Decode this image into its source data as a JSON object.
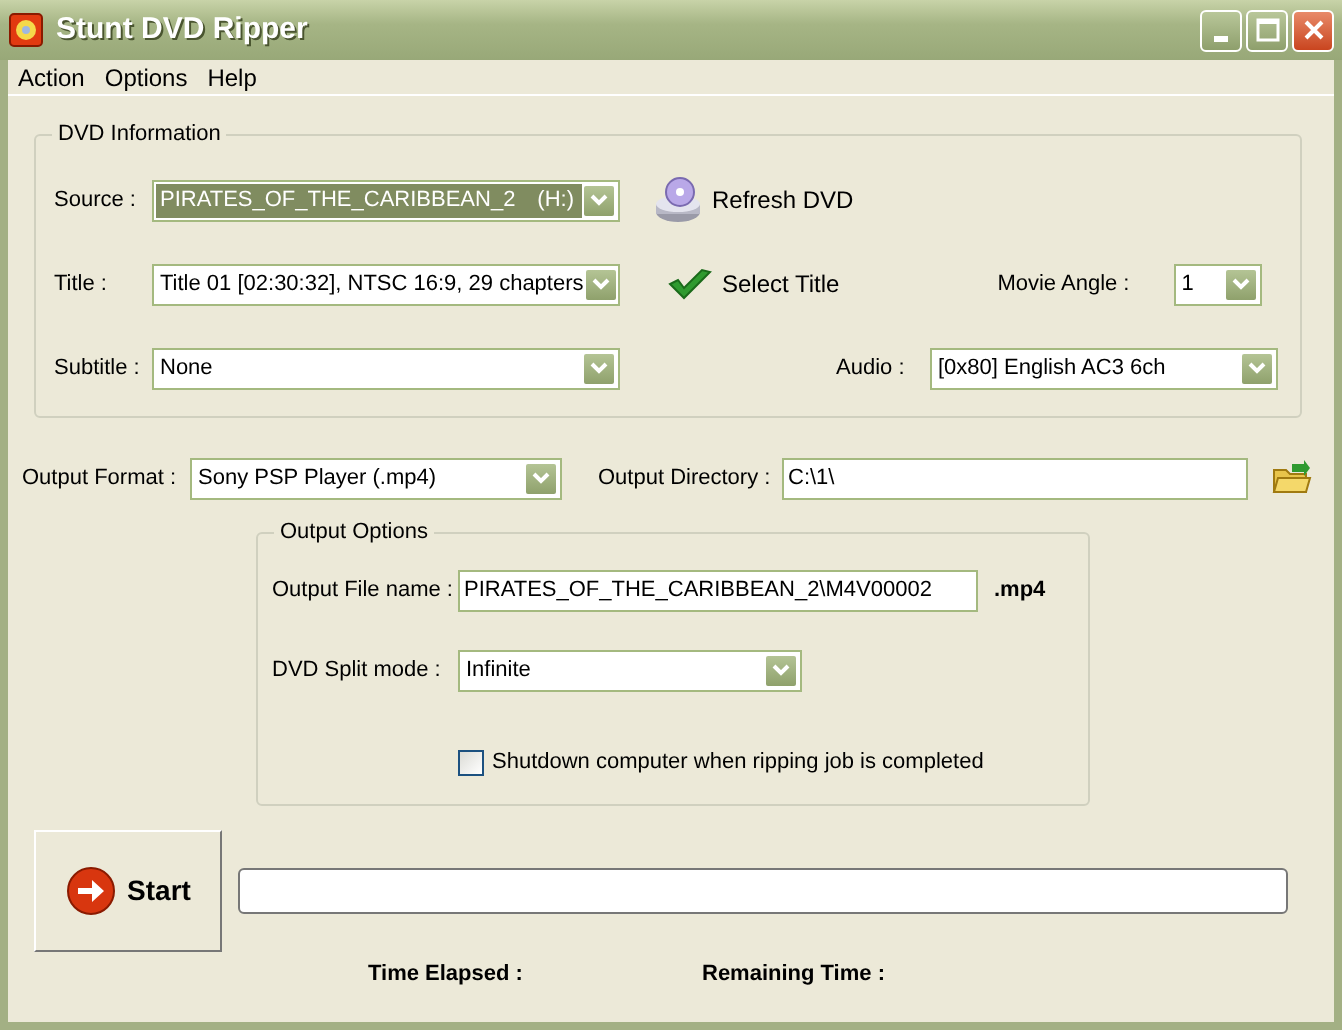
{
  "window": {
    "title": "Stunt DVD Ripper"
  },
  "menu": [
    "Action",
    "Options",
    "Help"
  ],
  "dvd_information": {
    "legend": "DVD Information",
    "source": {
      "label": "Source :",
      "value": "PIRATES_OF_THE_CARIBBEAN_2",
      "drive": "(H:)",
      "selected": true
    },
    "refresh_button": "Refresh DVD",
    "title": {
      "label": "Title :",
      "value": "Title 01 [02:30:32], NTSC 16:9, 29 chapters"
    },
    "select_title_button": "Select Title",
    "movie_angle": {
      "label": "Movie Angle :",
      "value": "1"
    },
    "subtitle": {
      "label": "Subtitle :",
      "value": "None"
    },
    "audio": {
      "label": "Audio :",
      "value": "[0x80] English AC3 6ch"
    }
  },
  "output_format": {
    "label": "Output Format :",
    "value": "Sony PSP Player (.mp4)"
  },
  "output_directory": {
    "label": "Output Directory :",
    "value": "C:\\1\\"
  },
  "output_options": {
    "legend": "Output Options",
    "file_name": {
      "label": "Output File name :",
      "value": "PIRATES_OF_THE_CARIBBEAN_2\\M4V00002",
      "extension": ".mp4"
    },
    "split_mode": {
      "label": "DVD Split mode :",
      "value": "Infinite"
    },
    "shutdown": {
      "label": "Shutdown computer when ripping job is completed",
      "checked": false
    }
  },
  "start_button": "Start",
  "progress": {
    "level": 0
  },
  "time_elapsed": "Time Elapsed :",
  "remaining_time": "Remaining Time :"
}
